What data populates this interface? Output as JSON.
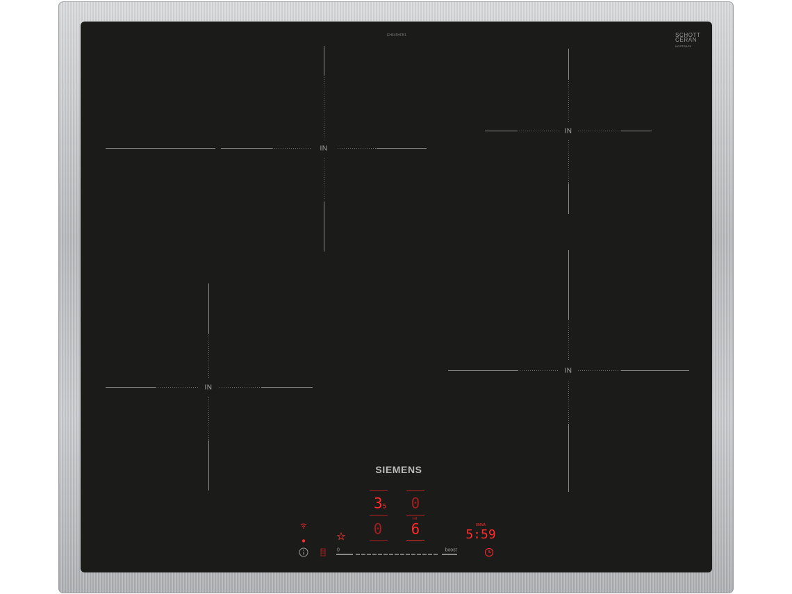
{
  "model_number": "EH645HFB1",
  "glass_brand": {
    "line1": "SCHOTT",
    "line2": "CERAN",
    "note": "NOSTRAFE"
  },
  "brand": "SIEMENS",
  "zone_label": "IN",
  "displays": {
    "zone_top_left": {
      "main": "3",
      "sub": "5"
    },
    "zone_top_right": "0",
    "zone_bottom_left": "0",
    "zone_bottom_right": "6",
    "zone_bottom_right_tag": "I-II",
    "timer_tag": "8MNA",
    "timer": "5:59"
  },
  "slider": {
    "min_label": "0",
    "max_label": "boost"
  },
  "icons": {
    "wifi": "wifi-icon",
    "indicator": "status-dot-icon",
    "favorite": "star-icon",
    "info": "info-icon",
    "lock": "child-lock-icon",
    "timer": "clock-icon"
  },
  "colors": {
    "glass": "#1b1b1a",
    "display_red": "#ff2a2a",
    "frame": "#c0c2c5"
  }
}
